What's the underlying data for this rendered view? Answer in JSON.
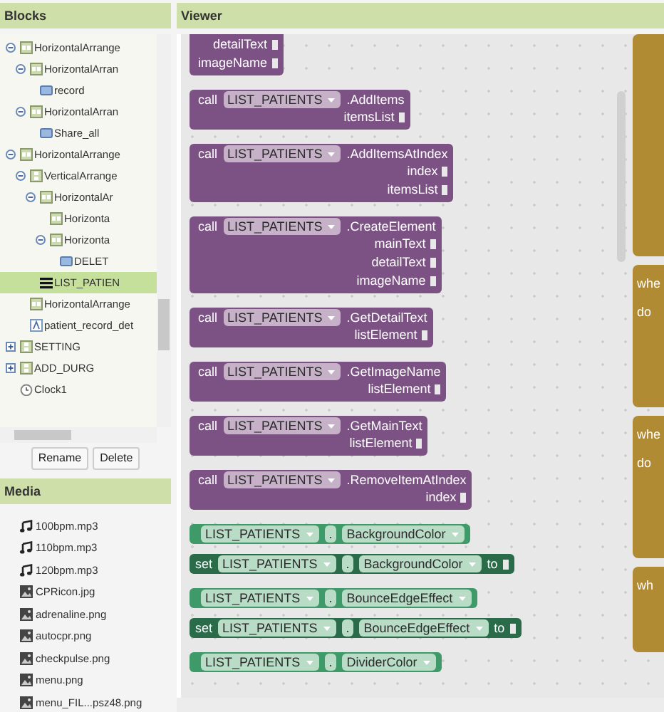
{
  "blocks_panel": {
    "title": "Blocks",
    "tree": [
      {
        "label": "HorizontalArrange",
        "kind": "hbox",
        "expanded": true,
        "selected": false,
        "children": [
          {
            "label": "HorizontalArran",
            "kind": "hbox",
            "expanded": true,
            "selected": false,
            "children": [
              {
                "label": "record",
                "kind": "button",
                "selected": false
              }
            ]
          },
          {
            "label": "HorizontalArran",
            "kind": "hbox",
            "expanded": true,
            "selected": false,
            "children": [
              {
                "label": "Share_all",
                "kind": "button",
                "selected": false
              }
            ]
          }
        ]
      },
      {
        "label": "HorizontalArrange",
        "kind": "hbox",
        "expanded": true,
        "selected": false,
        "children": [
          {
            "label": "VerticalArrange",
            "kind": "vbox",
            "expanded": true,
            "selected": false,
            "children": [
              {
                "label": "HorizontalAr",
                "kind": "hbox",
                "expanded": true,
                "selected": false,
                "children": [
                  {
                    "label": "Horizonta",
                    "kind": "hbox",
                    "selected": false
                  },
                  {
                    "label": "Horizonta",
                    "kind": "hbox",
                    "expanded": true,
                    "selected": false,
                    "children": [
                      {
                        "label": "DELET",
                        "kind": "button",
                        "selected": false
                      }
                    ]
                  }
                ]
              },
              {
                "label": "LIST_PATIEN",
                "kind": "listview",
                "selected": true
              }
            ]
          },
          {
            "label": "HorizontalArrange",
            "kind": "hbox",
            "selected": false
          },
          {
            "label": "patient_record_det",
            "kind": "label",
            "selected": false
          }
        ]
      },
      {
        "label": "SETTING",
        "kind": "vbox",
        "expanded": false,
        "selected": false
      },
      {
        "label": "ADD_DURG",
        "kind": "vbox",
        "expanded": false,
        "selected": false
      },
      {
        "label": "Clock1",
        "kind": "clock",
        "selected": false
      }
    ],
    "buttons": [
      "Rename",
      "Delete"
    ]
  },
  "media_panel": {
    "title": "Media",
    "files": [
      {
        "name": "100bpm.mp3",
        "kind": "audio"
      },
      {
        "name": "110bpm.mp3",
        "kind": "audio"
      },
      {
        "name": "120bpm.mp3",
        "kind": "audio"
      },
      {
        "name": "CPRicon.jpg",
        "kind": "image"
      },
      {
        "name": "adrenaline.png",
        "kind": "image"
      },
      {
        "name": "autocpr.png",
        "kind": "image"
      },
      {
        "name": "checkpulse.png",
        "kind": "image"
      },
      {
        "name": "menu.png",
        "kind": "image"
      },
      {
        "name": "menu_FIL...psz48.png",
        "kind": "image"
      }
    ]
  },
  "viewer": {
    "title": "Viewer",
    "blocks": [
      {
        "kind": "method",
        "args": [
          "detailText",
          "imageName"
        ]
      },
      {
        "kind": "method",
        "call": "call",
        "component": "LIST_PATIENTS",
        "member": ".AddItems",
        "args": [
          "itemsList"
        ]
      },
      {
        "kind": "method",
        "call": "call",
        "component": "LIST_PATIENTS",
        "member": ".AddItemsAtIndex",
        "args": [
          "index",
          "itemsList"
        ]
      },
      {
        "kind": "method",
        "call": "call",
        "component": "LIST_PATIENTS",
        "member": ".CreateElement",
        "args": [
          "mainText",
          "detailText",
          "imageName"
        ]
      },
      {
        "kind": "method",
        "call": "call",
        "component": "LIST_PATIENTS",
        "member": ".GetDetailText",
        "args": [
          "listElement"
        ]
      },
      {
        "kind": "method",
        "call": "call",
        "component": "LIST_PATIENTS",
        "member": ".GetImageName",
        "args": [
          "listElement"
        ]
      },
      {
        "kind": "method",
        "call": "call",
        "component": "LIST_PATIENTS",
        "member": ".GetMainText",
        "args": [
          "listElement"
        ]
      },
      {
        "kind": "method",
        "call": "call",
        "component": "LIST_PATIENTS",
        "member": ".RemoveItemAtIndex",
        "args": [
          "index"
        ]
      },
      {
        "kind": "getter",
        "component": "LIST_PATIENTS",
        "dot": ".",
        "member": "BackgroundColor"
      },
      {
        "kind": "setter",
        "set": "set",
        "component": "LIST_PATIENTS",
        "dot": ".",
        "member": "BackgroundColor",
        "to": "to"
      },
      {
        "kind": "getter",
        "component": "LIST_PATIENTS",
        "dot": ".",
        "member": "BounceEdgeEffect"
      },
      {
        "kind": "setter",
        "set": "set",
        "component": "LIST_PATIENTS",
        "dot": ".",
        "member": "BounceEdgeEffect",
        "to": "to"
      },
      {
        "kind": "getter",
        "component": "LIST_PATIENTS",
        "dot": ".",
        "member": "DividerColor"
      }
    ],
    "events": [
      {
        "kind": "event"
      },
      {
        "kind": "event",
        "lines": [
          "whe",
          "do"
        ]
      },
      {
        "kind": "event",
        "lines": [
          "whe",
          "do"
        ]
      },
      {
        "kind": "event",
        "lines": [
          "wh"
        ]
      }
    ]
  }
}
